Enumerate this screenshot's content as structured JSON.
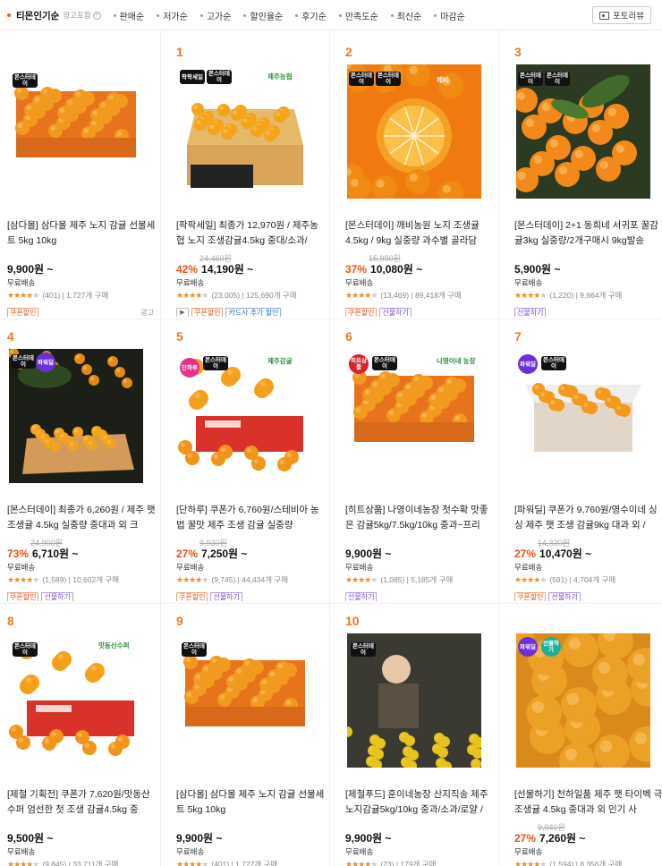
{
  "sort_bar": {
    "active": "티몬인기순",
    "ad_note": "광고포함",
    "options": [
      "판매순",
      "저가순",
      "고가순",
      "할인율순",
      "후기순",
      "만족도순",
      "최신순",
      "마감순"
    ],
    "photo_review": "포토리뷰"
  },
  "colors": {
    "accent": "#f2781c",
    "discount": "#e8521a",
    "star": "#f28a1c"
  },
  "products": [
    {
      "rank": "",
      "title": "[삼다몰] 삼다몰 제주 노지 감귤 선물세트 5kg 10kg",
      "orig": "",
      "pct": "",
      "price": "9,900원 ~",
      "ship": "무료배송",
      "rating": "(401)",
      "sold": "1,727개 구매",
      "tags": [
        "쿠폰할인"
      ],
      "ad": "광고",
      "img": "box"
    },
    {
      "rank": "1",
      "title": "[팍팍세일] 최종가 12,970원 / 제주농협 노지 조생감귤4.5kg 중대/소과/",
      "orig": "24,460원",
      "pct": "42%",
      "price": "14,190원 ~",
      "ship": "무료배송",
      "rating": "(23,005)",
      "sold": "125,690개 구매",
      "tags": [
        "▶",
        "쿠폰할인",
        "카드사 추가 할인"
      ],
      "ad": "",
      "img": "openbox",
      "brand": "제주농협"
    },
    {
      "rank": "2",
      "title": "[몬스터데이] 깨비농원 노지 조생귤 4.5kg / 9kg 실중량 과수별 골라담",
      "orig": "15,990원",
      "pct": "37%",
      "price": "10,080원 ~",
      "ship": "무료배송",
      "rating": "(13,469)",
      "sold": "89,418개 구매",
      "tags": [
        "쿠폰할인",
        "선물하기"
      ],
      "ad": "",
      "img": "cut",
      "brand": "깨비"
    },
    {
      "rank": "3",
      "title": "[몬스터데이] 2+1 동희네 서귀포 꿀감귤3kg 실중량/2개구매시 9kg발송",
      "orig": "",
      "pct": "",
      "price": "5,900원 ~",
      "ship": "무료배송",
      "rating": "(1,220)",
      "sold": "9,664개 구매",
      "tags": [
        "선물하기"
      ],
      "ad": "",
      "img": "leaves"
    },
    {
      "rank": "4",
      "title": "[몬스터데이] 최종가 6,260원 / 제주 햇 조생귤 4.5kg 실중량 중대과 외 크",
      "orig": "24,900원",
      "pct": "73%",
      "price": "6,710원 ~",
      "ship": "무료배송",
      "rating": "(1,589)",
      "sold": "10,602개 구매",
      "tags": [
        "쿠폰할인",
        "선물하기"
      ],
      "ad": "",
      "img": "dark"
    },
    {
      "rank": "5",
      "title": "[단하루] 쿠폰가 6,760원/스테비아 농법 꿀맛 제주 조생 감귤 실중량",
      "orig": "9,930원",
      "pct": "27%",
      "price": "7,250원 ~",
      "ship": "무료배송",
      "rating": "(9,745)",
      "sold": "44,434개 구매",
      "tags": [
        "쿠폰할인",
        "선물하기"
      ],
      "ad": "",
      "img": "redbox",
      "brand": "제주감귤"
    },
    {
      "rank": "6",
      "title": "[히트상품] 나영이네농장 첫수확 맛좋은 감귤5kg/7.5kg/10kg 중과~프리",
      "orig": "",
      "pct": "",
      "price": "9,900원 ~",
      "ship": "무료배송",
      "rating": "(1,085)",
      "sold": "5,185개 구매",
      "tags": [
        "선물하기"
      ],
      "ad": "",
      "img": "box",
      "brand": "나영이네 농장"
    },
    {
      "rank": "7",
      "title": "[파워딜] 쿠폰가 9,760원/영수이네 싱싱 제주 햇 조생 감귤9kg 대과 외 /",
      "orig": "14,330원",
      "pct": "27%",
      "price": "10,470원 ~",
      "ship": "무료배송",
      "rating": "(591)",
      "sold": "4,704개 구매",
      "tags": [
        "쿠폰할인",
        "선물하기"
      ],
      "ad": "",
      "img": "openwhite"
    },
    {
      "rank": "8",
      "title": "[제철 기획전] 쿠폰가 7,620원/맛동산수퍼 엄선한 첫 조생 감귤4.5kg 중",
      "orig": "",
      "pct": "",
      "price": "9,500원 ~",
      "ship": "무료배송",
      "rating": "(9,845)",
      "sold": "33,711개 구매",
      "tags": [],
      "ad": "",
      "img": "redbox",
      "brand": "맛동산수퍼"
    },
    {
      "rank": "9",
      "title": "[삼다몰] 삼다몰 제주 노지 감귤 선물세트 5kg 10kg",
      "orig": "",
      "pct": "",
      "price": "9,900원 ~",
      "ship": "무료배송",
      "rating": "(401)",
      "sold": "1,727개 구매",
      "tags": [],
      "ad": "",
      "img": "box"
    },
    {
      "rank": "10",
      "title": "[제철푸드] 훈이네농장 산지직송 제주노지감귤5kg/10kg 중과/소과/로얄 /",
      "orig": "",
      "pct": "",
      "price": "9,900원 ~",
      "ship": "무료배송",
      "rating": "(23)",
      "sold": "179개 구매",
      "tags": [],
      "ad": "",
      "img": "farmer"
    },
    {
      "rank": "",
      "title": "[선물하기] 천하일품 제주 햇 타이벡 극조생귤 4.5kg 중대과 외 인기 사",
      "orig": "9,940원",
      "pct": "27%",
      "price": "7,260원 ~",
      "ship": "무료배송",
      "rating": "(1,594)",
      "sold": "8,356개 구매",
      "tags": [],
      "ad": "",
      "img": "closeup"
    }
  ],
  "badge_texts": {
    "monster": "몬스터데이",
    "pakpak": "팍팍세일",
    "power": "파워딜",
    "oneday": "단하루",
    "hit": "히트상품",
    "gift": "선물하기"
  }
}
